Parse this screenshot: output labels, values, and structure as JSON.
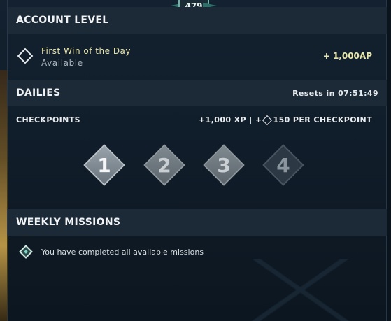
{
  "badge": {
    "level": "479"
  },
  "account_level": {
    "title": "ACCOUNT LEVEL",
    "reward_name": "First Win of the Day",
    "reward_status": "Available",
    "reward_value": "+ 1,000AP"
  },
  "dailies": {
    "title": "DAILIES",
    "resets": "Resets in 07:51:49",
    "checkpoints_label": "CHECKPOINTS",
    "xp_text": "+1,000 XP | +",
    "per_checkpoint": "150 PER CHECKPOINT",
    "checkpoints": [
      {
        "label": "1",
        "state": "completed"
      },
      {
        "label": "2",
        "state": "partial"
      },
      {
        "label": "3",
        "state": "partial"
      },
      {
        "label": "4",
        "state": "locked"
      }
    ]
  },
  "weekly": {
    "title": "WEEKLY MISSIONS",
    "message": "You have completed all available missions"
  },
  "colors": {
    "accent_yellow": "#e9e6a8",
    "accent_teal": "#6fb6a9",
    "background": "#0d1620",
    "header_bg": "#1c2a38"
  },
  "icons": {
    "account_reward": "diamond-outline-icon",
    "kingdom_credit": "kingdom-credit-icon",
    "weekly": "mission-diamond-icon"
  }
}
